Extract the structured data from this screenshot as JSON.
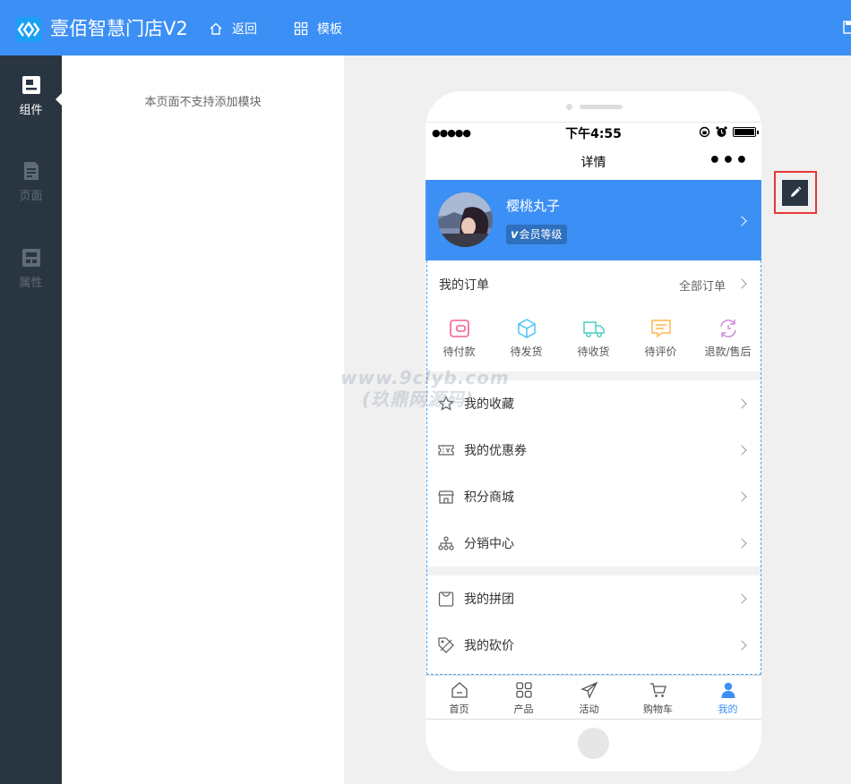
{
  "header": {
    "app_title": "壹佰智慧门店V2",
    "nav_back": "返回",
    "nav_template": "模板"
  },
  "rail": {
    "items": [
      {
        "label": "组件",
        "icon": "component-icon",
        "active": true
      },
      {
        "label": "页面",
        "icon": "page-icon",
        "active": false
      },
      {
        "label": "属性",
        "icon": "property-icon",
        "active": false
      }
    ]
  },
  "panel": {
    "message": "本页面不支持添加模块"
  },
  "phone": {
    "status_time": "下午4:55",
    "nav_title": "详情",
    "more_label": "•••"
  },
  "profile": {
    "username": "樱桃丸子",
    "level_badge": "v",
    "level_label": "会员等级"
  },
  "orders": {
    "title": "我的订单",
    "all_label": "全部订单",
    "items": [
      {
        "label": "待付款",
        "icon": "wallet-icon",
        "color": "#f06292"
      },
      {
        "label": "待发货",
        "icon": "box-icon",
        "color": "#4fc3f7"
      },
      {
        "label": "待收货",
        "icon": "truck-icon",
        "color": "#4dd0c4"
      },
      {
        "label": "待评价",
        "icon": "comment-icon",
        "color": "#ffb74d"
      },
      {
        "label": "退款/售后",
        "icon": "refund-icon",
        "color": "#ce93d8"
      }
    ]
  },
  "menu_group_1": [
    {
      "label": "我的收藏",
      "icon": "star-icon"
    },
    {
      "label": "我的优惠券",
      "icon": "coupon-icon"
    },
    {
      "label": "积分商城",
      "icon": "store-icon"
    },
    {
      "label": "分销中心",
      "icon": "network-icon"
    }
  ],
  "menu_group_2": [
    {
      "label": "我的拼团",
      "icon": "bag-icon"
    },
    {
      "label": "我的砍价",
      "icon": "tag-icon"
    }
  ],
  "tabbar": [
    {
      "label": "首页",
      "icon": "home-icon",
      "active": false
    },
    {
      "label": "产品",
      "icon": "grid-icon",
      "active": false
    },
    {
      "label": "活动",
      "icon": "plane-icon",
      "active": false
    },
    {
      "label": "购物车",
      "icon": "cart-icon",
      "active": false
    },
    {
      "label": "我的",
      "icon": "user-icon",
      "active": true
    }
  ],
  "watermark": {
    "line1": "www.9clyb.com",
    "line2": "(玖鼎网源码)"
  },
  "colors": {
    "brand": "#3c8ff4",
    "rail_bg": "#2a3542",
    "highlight": "#e53935"
  }
}
